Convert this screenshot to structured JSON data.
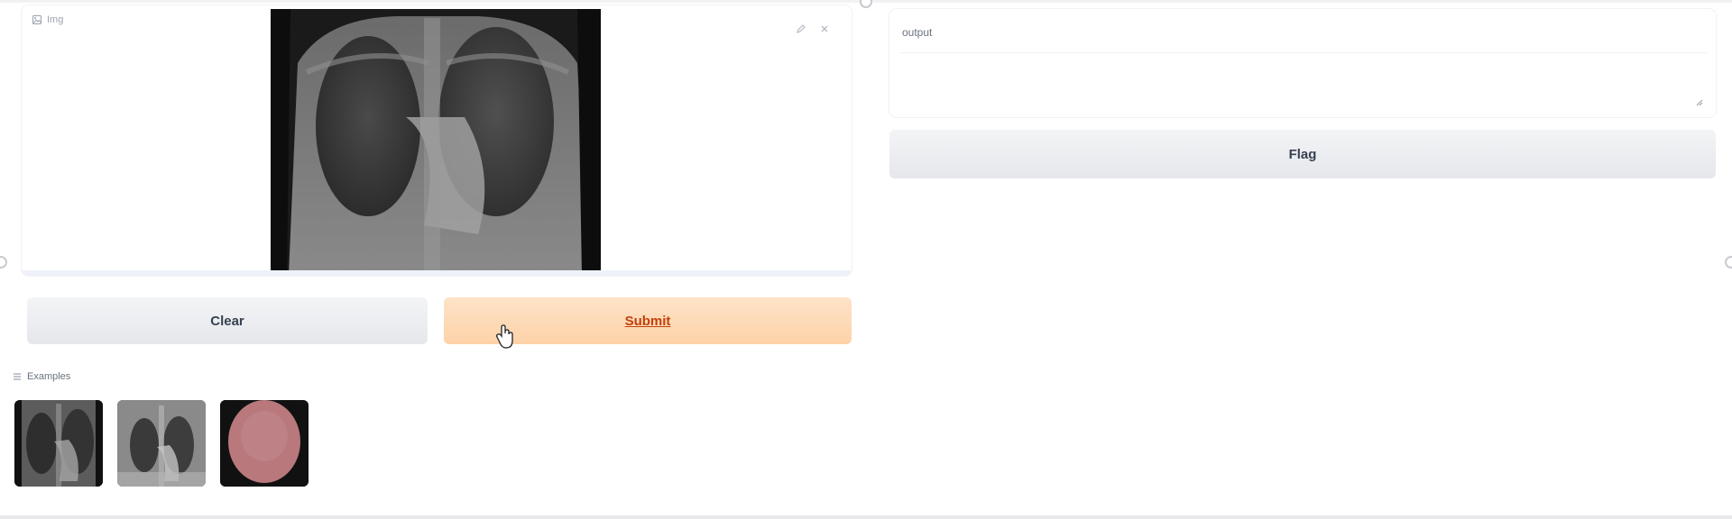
{
  "input_panel": {
    "label": "Img",
    "actions": [
      "pencil-icon",
      "close-icon"
    ]
  },
  "buttons": {
    "clear": "Clear",
    "submit": "Submit",
    "flag": "Flag"
  },
  "examples": {
    "label": "Examples",
    "items": [
      "xray-example-1",
      "xray-example-2",
      "pink-example-3"
    ]
  },
  "output_panel": {
    "label": "output",
    "value": ""
  },
  "colors": {
    "submit_bg": "#fdd2a8",
    "submit_text": "#c2410c",
    "secondary_bg": "#e5e7eb"
  }
}
